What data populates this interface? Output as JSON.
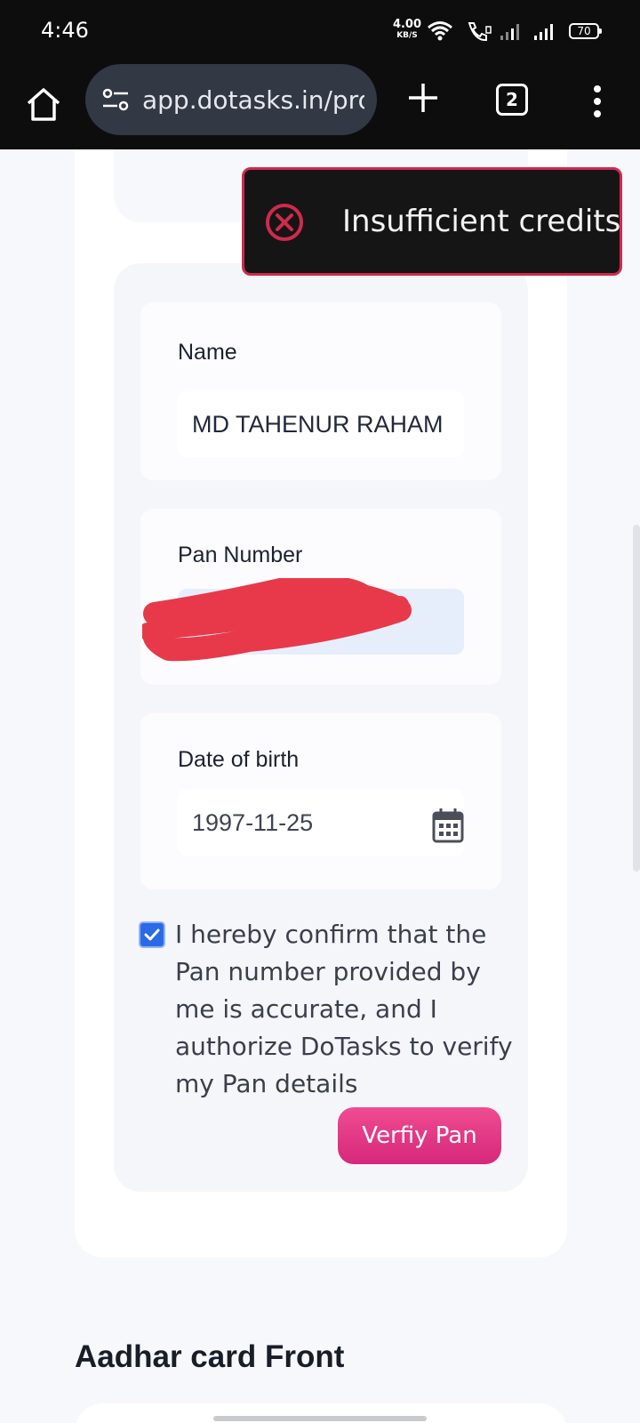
{
  "status_bar": {
    "time": "4:46",
    "net_speed_value": "4.00",
    "net_speed_unit": "KB/S",
    "battery_level": "70"
  },
  "browser": {
    "url": "app.dotasks.in/profile",
    "tab_count": "2"
  },
  "toast": {
    "message": "Insufficient credits",
    "accent_color": "#d02a4c"
  },
  "pan_form": {
    "name": {
      "label": "Name",
      "value": "MD TAHENUR RAHAM"
    },
    "pan": {
      "label": "Pan Number",
      "value": ""
    },
    "dob": {
      "label": "Date of birth",
      "value": "1997-11-25"
    },
    "consent": {
      "checked": true,
      "text": "I hereby confirm that the Pan number provided by me is accurate, and I authorize DoTasks to verify my Pan details"
    },
    "verify_button": "Verfiy Pan"
  },
  "next_section": {
    "title": "Aadhar card Front"
  },
  "colors": {
    "primary_button": "#e03a86",
    "checkbox": "#2a6ae6",
    "redaction": "#e8394a"
  }
}
